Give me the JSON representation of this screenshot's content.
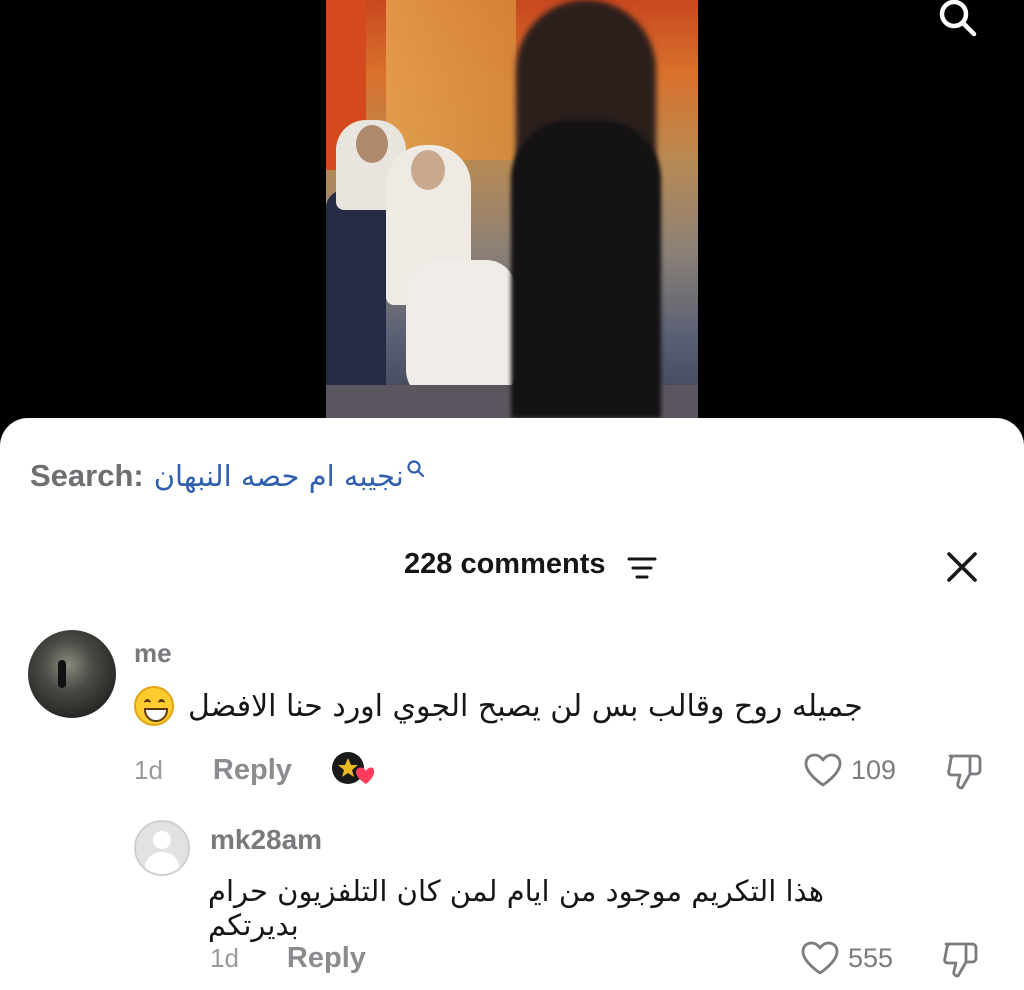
{
  "search": {
    "prefix": "Search:",
    "query": "نجيبه ام حصه النبهان"
  },
  "comments_header": {
    "count_label": "228 comments"
  },
  "comments": [
    {
      "username": "me",
      "text": "جميله روح وقالب بس لن يصبح الجوي اورد حنا الافضل",
      "emoji": "grinning-face",
      "time": "1d",
      "reply_label": "Reply",
      "likes": "109",
      "creator_liked": true
    },
    {
      "username": "mk28am",
      "text": "هذا التكريم موجود من ايام لمن كان التلفزيون حرام بديرتكم",
      "time": "1d",
      "reply_label": "Reply",
      "likes": "555"
    }
  ],
  "colors": {
    "search_query": "#2f5fb0",
    "heart_badge": "#ff3b5c",
    "text_primary": "#161616",
    "text_secondary": "#8c8c90"
  }
}
